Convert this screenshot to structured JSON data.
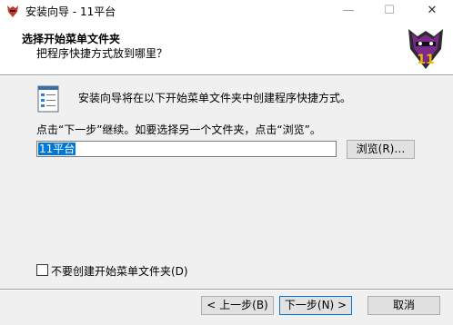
{
  "window": {
    "title": "安装向导 - 11平台",
    "minimize": "—",
    "maximize": "☐",
    "close": "✕"
  },
  "header": {
    "title": "选择开始菜单文件夹",
    "subtitle": "把程序快捷方式放到哪里？"
  },
  "main": {
    "message1": "安装向导将在以下开始菜单文件夹中创建程序快捷方式。",
    "message2": "点击“下一步”继续。如要选择另一个文件夹，点击“浏览”。",
    "folder_value": "11平台",
    "browse_label": "浏览(R)…",
    "no_folder_label": "不要创建开始菜单文件夹(D)"
  },
  "footer": {
    "back_label": "< 上一步(B)",
    "next_label": "下一步(N) >",
    "cancel_label": "取消"
  }
}
